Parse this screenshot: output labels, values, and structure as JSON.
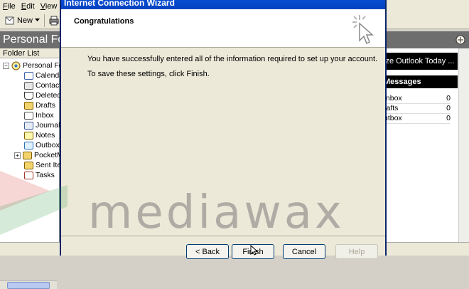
{
  "menubar": {
    "items": [
      "File",
      "Edit",
      "View"
    ]
  },
  "toolbar": {
    "new_label": "New"
  },
  "banner": {
    "title": "Personal Fo"
  },
  "folder_list": {
    "header": "Folder List",
    "root": "Personal Fo",
    "items": [
      {
        "label": "Calenda",
        "icon": "calendar-icon"
      },
      {
        "label": "Contact",
        "icon": "contacts-icon"
      },
      {
        "label": "Deleted",
        "icon": "deleted-items-icon"
      },
      {
        "label": "Drafts",
        "icon": "drafts-icon"
      },
      {
        "label": "Inbox",
        "icon": "inbox-icon"
      },
      {
        "label": "Journal",
        "icon": "journal-icon"
      },
      {
        "label": "Notes",
        "icon": "notes-icon"
      },
      {
        "label": "Outbox",
        "icon": "outbox-icon"
      },
      {
        "label": "PocketM",
        "icon": "folder-icon"
      },
      {
        "label": "Sent Ite",
        "icon": "sent-items-icon"
      },
      {
        "label": "Tasks",
        "icon": "tasks-icon"
      }
    ]
  },
  "outlook_today": {
    "customize": "ize Outlook Today ...",
    "messages_header": "Messages",
    "rows": [
      {
        "name": "Inbox",
        "count": "0"
      },
      {
        "name": "rafts",
        "count": "0"
      },
      {
        "name": "utbox",
        "count": "0"
      }
    ]
  },
  "wizard": {
    "title": "Internet Connection Wizard",
    "heading": "Congratulations",
    "line1": "You have successfully entered all of the information required to set up your account.",
    "line2": "To save these settings, click Finish.",
    "buttons": {
      "back": "< Back",
      "finish": "Finish",
      "cancel": "Cancel",
      "help": "Help"
    }
  },
  "watermark": {
    "text": "mediawax"
  },
  "colors": {
    "title_bar": "#0a4fd6",
    "dialog_bg": "#ece9d8",
    "banner_bg": "#6e6e6e"
  }
}
